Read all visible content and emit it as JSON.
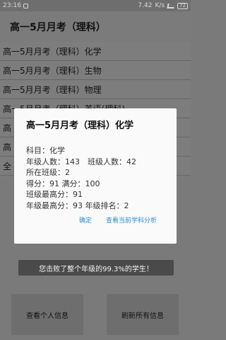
{
  "status": {
    "time": "23:16",
    "speed": "7.42",
    "speed_unit": "K/s",
    "battery": "72"
  },
  "header": {
    "title": "高一5月月考（理科）"
  },
  "list": {
    "items": [
      {
        "label": "高一5月月考（理科）化学"
      },
      {
        "label": "高一5月月考（理科）生物"
      },
      {
        "label": "高一5月月考（理科）物理"
      },
      {
        "label": "高一5月月考（理科）英语(理科)"
      },
      {
        "label": "高"
      },
      {
        "label": "高"
      },
      {
        "label": "全"
      }
    ]
  },
  "dialog": {
    "title": "高一5月月考（理科）化学",
    "lines": [
      {
        "text": "科目：化学"
      },
      {
        "text": "年级人数：143　班级人数：42"
      },
      {
        "text": "所在班级：2"
      },
      {
        "text": "得分：91 满分：100"
      },
      {
        "text": "班级最高分：91"
      },
      {
        "text": "年级最高分：93 年级排名：2"
      }
    ],
    "confirm_label": "确定",
    "analysis_label": "查看当前学科分析"
  },
  "banner": {
    "text": "您击败了整个年级的99.3%的学生！"
  },
  "buttons": {
    "personal_info": "查看个人信息",
    "refresh_all": "刷新所有信息"
  }
}
